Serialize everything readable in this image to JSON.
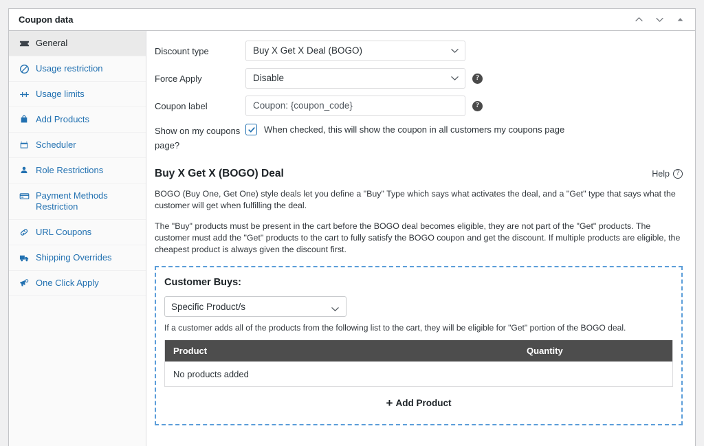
{
  "panel": {
    "title": "Coupon data",
    "header_actions": [
      {
        "name": "move-up-icon",
        "icon": "chevron-up"
      },
      {
        "name": "move-down-icon",
        "icon": "chevron-down"
      },
      {
        "name": "toggle-panel-icon",
        "icon": "triangle-up"
      }
    ]
  },
  "sidebar": {
    "items": [
      {
        "label": "General",
        "icon": "ticket-icon",
        "active": true
      },
      {
        "label": "Usage restriction",
        "icon": "ban-icon",
        "active": false
      },
      {
        "label": "Usage limits",
        "icon": "limits-icon",
        "active": false
      },
      {
        "label": "Add Products",
        "icon": "bag-icon",
        "active": false
      },
      {
        "label": "Scheduler",
        "icon": "calendar-icon",
        "active": false
      },
      {
        "label": "Role Restrictions",
        "icon": "user-icon",
        "active": false
      },
      {
        "label": "Payment Methods Restriction",
        "icon": "credit-card-icon",
        "active": false
      },
      {
        "label": "URL Coupons",
        "icon": "link-icon",
        "active": false
      },
      {
        "label": "Shipping Overrides",
        "icon": "truck-icon",
        "active": false
      },
      {
        "label": "One Click Apply",
        "icon": "megaphone-icon",
        "active": false
      }
    ]
  },
  "form": {
    "discount_type": {
      "label": "Discount type",
      "value": "Buy X Get X Deal (BOGO)"
    },
    "force_apply": {
      "label": "Force Apply",
      "value": "Disable",
      "help": "?"
    },
    "coupon_label": {
      "label": "Coupon label",
      "value": "Coupon: {coupon_code}",
      "placeholder": "Coupon: {coupon_code}",
      "help": "?"
    },
    "show_on_my_coupons": {
      "label": "Show on my coupons page?",
      "checked": true,
      "description": "When checked, this will show the coupon in all customers my coupons page"
    }
  },
  "bogo": {
    "title": "Buy X Get X (BOGO) Deal",
    "help_label": "Help",
    "help_icon_char": "?",
    "paragraph_1": "BOGO (Buy One, Get One) style deals let you define a \"Buy\" Type which says what activates the deal, and a \"Get\" type that says what the customer will get when fulfilling the deal.",
    "paragraph_2": "The \"Buy\" products must be present in the cart before the BOGO deal becomes eligible, they are not part of the \"Get\" products. The customer must add the \"Get\" products to the cart to fully satisfy the BOGO coupon and get the discount. If multiple products are eligible, the cheapest product is always given the discount first."
  },
  "customer_buys": {
    "title": "Customer Buys:",
    "type_value": "Specific Product/s",
    "hint": "If a customer adds all of the products from the following list to the cart, they will be eligible for \"Get\" portion of the BOGO deal.",
    "table": {
      "columns": [
        "Product",
        "Quantity"
      ],
      "empty_text": "No products added",
      "rows": []
    },
    "add_button": {
      "plus": "+",
      "label": "Add Product"
    }
  },
  "colors": {
    "link": "#2271b1",
    "dashed_border": "#5b9dd9",
    "table_header_bg": "#4d4d4d",
    "page_bg": "#f0f0f1",
    "active_item_bg": "#eaeaea"
  }
}
